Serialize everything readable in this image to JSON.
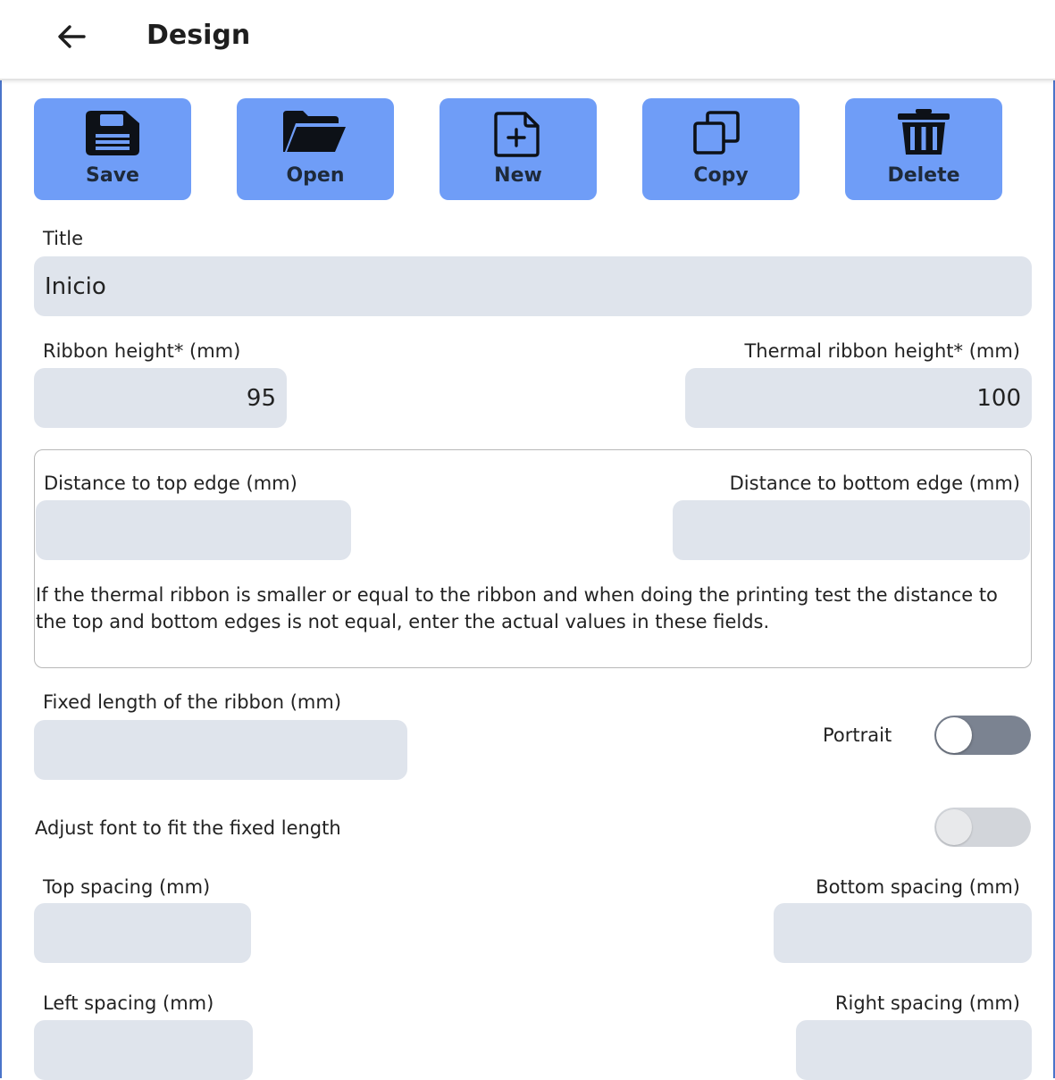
{
  "header": {
    "title": "Design",
    "back_icon": "arrow-left-icon"
  },
  "toolbar": {
    "accent": "#6f9df7",
    "buttons": [
      {
        "label": "Save",
        "icon": "floppy-disk-icon"
      },
      {
        "label": "Open",
        "icon": "folder-open-icon"
      },
      {
        "label": "New",
        "icon": "file-plus-icon"
      },
      {
        "label": "Copy",
        "icon": "copy-icon"
      },
      {
        "label": "Delete",
        "icon": "trash-icon"
      }
    ]
  },
  "form": {
    "title_label": "Title",
    "title_value": "Inicio",
    "ribbon_height_label": "Ribbon height* (mm)",
    "ribbon_height_value": "95",
    "thermal_height_label": "Thermal ribbon height* (mm)",
    "thermal_height_value": "100",
    "top_edge_label": "Distance to top edge (mm)",
    "top_edge_value": "",
    "bottom_edge_label": "Distance to bottom edge (mm)",
    "bottom_edge_value": "",
    "edge_note": "If the thermal ribbon is smaller or equal to the ribbon and when doing the printing test the distance to the top and bottom edges is not equal, enter the actual values in these fields.",
    "fixed_length_label": "Fixed length of the ribbon (mm)",
    "fixed_length_value": "",
    "portrait_label": "Portrait",
    "portrait_on": false,
    "adjust_font_label": "Adjust font to fit the fixed length",
    "adjust_font_on": false,
    "top_spacing_label": "Top spacing (mm)",
    "bottom_spacing_label": "Bottom spacing (mm)",
    "left_spacing_label": "Left spacing (mm)",
    "right_spacing_label": "Right spacing (mm)"
  }
}
